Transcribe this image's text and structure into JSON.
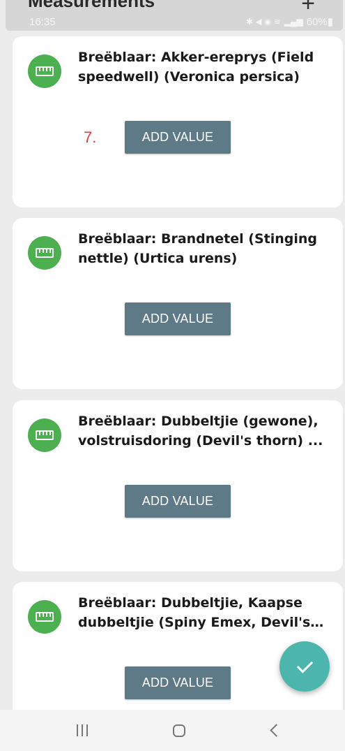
{
  "app": {
    "title": "Measurements",
    "add_label": "+"
  },
  "status_bar": {
    "time": "16:35",
    "icons": "✱ ◀ ◉ ≋ ",
    "signal": "▂▄▆",
    "battery": "60%▮"
  },
  "cards": [
    {
      "title": "Breëblaar: Akker-ereprys (Field speedwell) (Veronica persica)",
      "button": "ADD VALUE",
      "annotation": "7."
    },
    {
      "title": "Breëblaar: Brandnetel (Stinging nettle) (Urtica urens)",
      "button": "ADD VALUE"
    },
    {
      "title": "Breëblaar: Dubbeltjie (gewone), volstruisdoring (Devil's thorn) ...",
      "button": "ADD VALUE"
    },
    {
      "title": "Breëblaar: Dubbeltjie, Kaapse dubbeltjie (Spiny Emex, Devil's ...",
      "button": "ADD VALUE"
    }
  ],
  "icons": {
    "card_icon": "ruler-icon",
    "fab": "check-icon",
    "nav": [
      "recents-icon",
      "home-icon",
      "back-icon"
    ]
  },
  "colors": {
    "accent_green": "#4caf50",
    "button": "#5e7a87",
    "fab": "#4db6ac",
    "annotation": "#e53935"
  }
}
